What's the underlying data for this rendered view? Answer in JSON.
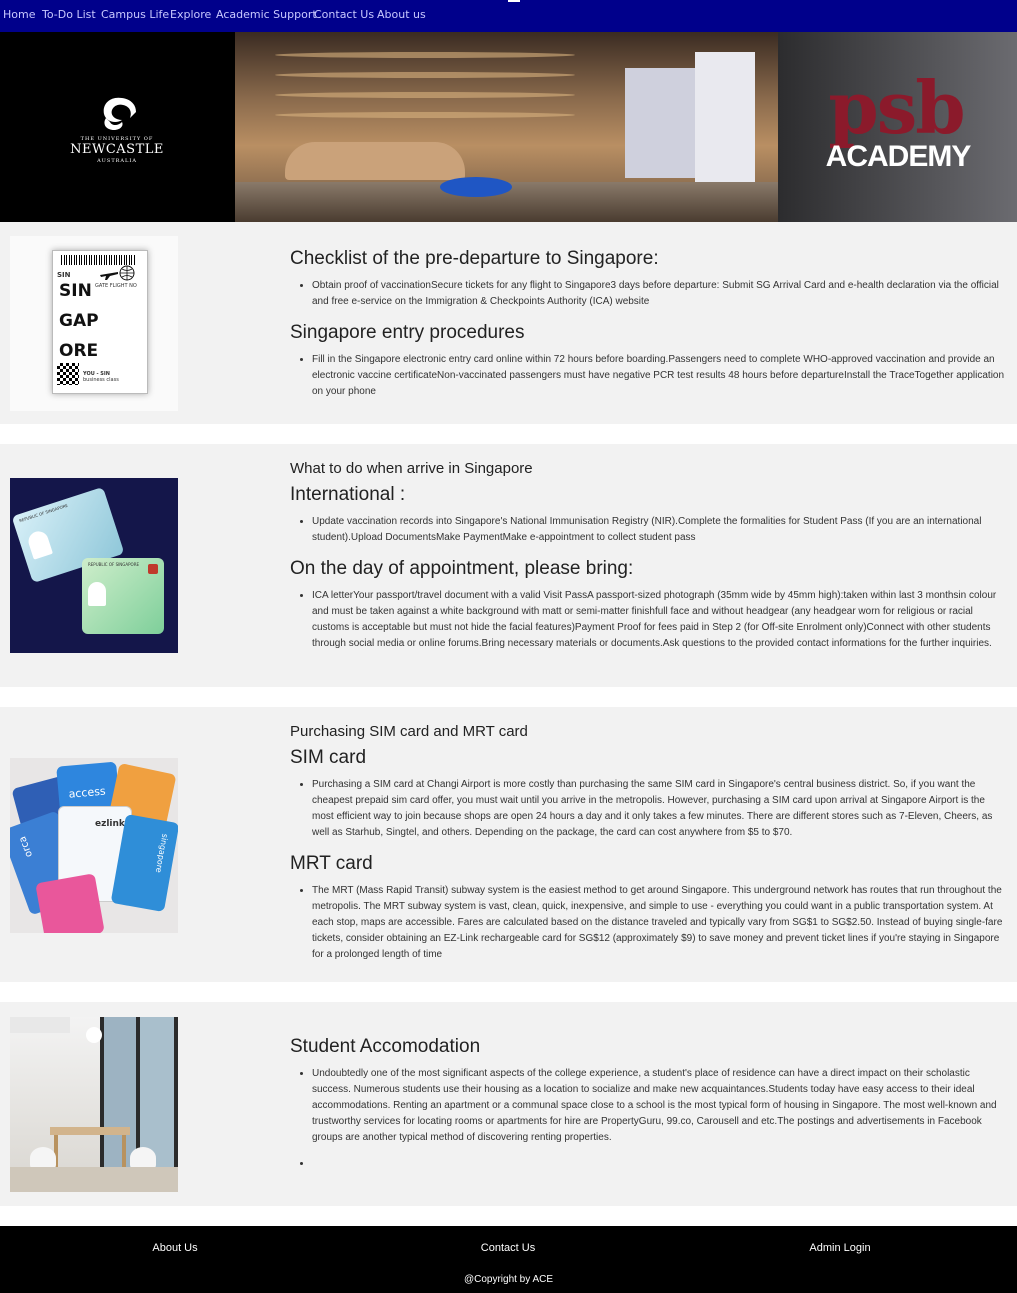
{
  "nav": {
    "items": [
      "Home",
      "To-Do List",
      "Campus Life",
      "Explore",
      "Academic Support",
      "Contact Us",
      "About us"
    ]
  },
  "hero": {
    "uon_line1": "THE UNIVERSITY OF",
    "uon_line2": "NEWCASTLE",
    "uon_line3": "AUSTRALIA",
    "psb": "psb",
    "academy": "ACADEMY"
  },
  "boarding_pass": {
    "sin": "SIN",
    "gate_flight": "GATE  FLIGHT NO",
    "lines": [
      "SIN",
      "GAP",
      "ORE"
    ],
    "footer": "YOU - SIN",
    "footer2": "business class"
  },
  "id_cards": {
    "front_title": "REPUBLIC OF SINGAPORE",
    "back_title": "REPUBLIC OF SINGAPORE"
  },
  "sim_cards": {
    "labels": [
      "access",
      "orca",
      "ezlink",
      "singapore"
    ]
  },
  "sections": [
    {
      "heading1": "Checklist of the pre-departure to Singapore:",
      "bullet1": "Obtain proof of vaccinationSecure tickets for any flight to Singapore3 days before departure: Submit SG Arrival Card and e-health declaration via the official and free e-service on the Immigration & Checkpoints Authority (ICA) website",
      "heading2": "Singapore entry procedures",
      "bullet2": "Fill in the Singapore electronic entry card online within 72 hours before boarding.Passengers need to complete WHO-approved vaccination and provide an electronic vaccine certificateNon-vaccinated passengers must have negative PCR test results 48 hours before departureInstall the TraceTogether application on your phone"
    },
    {
      "subtitle": "What to do when arrive in Singapore",
      "heading1": "International :",
      "bullet1": "Update vaccination records into Singapore's National Immunisation Registry (NIR).Complete the formalities for Student Pass (If you are an international student).Upload DocumentsMake PaymentMake e-appointment to collect student pass",
      "heading2": "On the day of appointment, please bring:",
      "bullet2": "ICA letterYour passport/travel document with a valid Visit PassA passport-sized photograph (35mm wide by 45mm high):taken within last 3 monthsin colour and must be taken against a white background with matt or semi-matter finishfull face and without headgear (any headgear worn for religious or racial customs is acceptable but must not hide the facial features)Payment Proof for fees paid in Step 2 (for Off-site Enrolment only)Connect with other students through social media or online forums.Bring necessary materials or documents.Ask questions to the provided contact informations for the further inquiries."
    },
    {
      "subtitle": "Purchasing SIM card and MRT card",
      "heading1": "SIM card",
      "bullet1": "Purchasing a SIM card at Changi Airport is more costly than purchasing the same SIM card in Singapore's central business district. So, if you want the cheapest prepaid sim card offer, you must wait until you arrive in the metropolis. However, purchasing a SIM card upon arrival at Singapore Airport is the most efficient way to join because shops are open 24 hours a day and it only takes a few minutes. There are different stores such as 7-Eleven, Cheers, as well as Starhub, Singtel, and others. Depending on the package, the card can cost anywhere from $5 to $70.",
      "heading2": "MRT card",
      "bullet2": "The MRT (Mass Rapid Transit) subway system is the easiest method to get around Singapore. This underground network has routes that run throughout the metropolis. The MRT subway system is vast, clean, quick, inexpensive, and simple to use - everything you could want in a public transportation system. At each stop, maps are accessible. Fares are calculated based on the distance traveled and typically vary from SG$1 to SG$2.50. Instead of buying single-fare tickets, consider obtaining an EZ-Link rechargeable card for SG$12 (approximately $9) to save money and prevent ticket lines if you're staying in Singapore for a prolonged length of time"
    },
    {
      "heading1": "Student Accomodation",
      "bullet1": "Undoubtedly one of the most significant aspects of the college experience, a student's place of residence can have a direct impact on their scholastic success. Numerous students use their housing as a location to socialize and make new acquaintances.Students today have easy access to their ideal accommodations. Renting an apartment or a communal space close to a school is the most typical form of housing in Singapore. The most well-known and trustworthy services for locating rooms or apartments for hire are PropertyGuru, 99.co, Carousell and etc.The postings and advertisements in Facebook groups are another typical method of discovering renting properties.",
      "bullet2": ""
    }
  ],
  "footer": {
    "about": "About Us",
    "contact": "Contact Us",
    "admin": "Admin Login",
    "copyright": "@Copyright by ACE"
  },
  "colors": {
    "nav_bg": "#00008b",
    "section_bg": "#f2f2f2",
    "footer_bg": "#000000",
    "psb_red": "#8b1a2b"
  }
}
